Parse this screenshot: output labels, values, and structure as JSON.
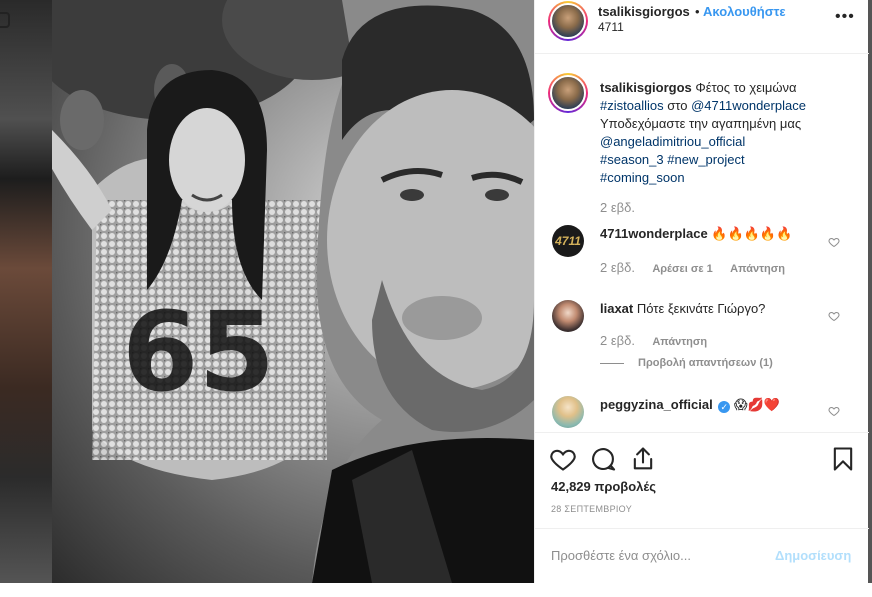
{
  "post": {
    "username": "tsalikisgiorgos",
    "separator": "•",
    "follow_label": "Ακολουθήστε",
    "location": "4711",
    "more_label": "•••",
    "caption": {
      "username": "tsalikisgiorgos",
      "text_1": "Φέτος το χειμώνα",
      "tag_zisto": "#zistoallios",
      "text_2": "στο",
      "mention_4711": "@4711wonderplace",
      "text_3": "Υποδεχόμαστε την αγαπημένη μας",
      "mention_angela": "@angeladimitriou_official",
      "tag_season": "#season_3",
      "tag_project": "#new_project",
      "tag_coming": "#coming_soon",
      "time": "2 εβδ."
    },
    "comments": [
      {
        "username": "4711wonderplace",
        "avatar_text": "4711",
        "text": "🔥🔥🔥🔥🔥",
        "time": "2 εβδ.",
        "likes": "Αρέσει σε 1",
        "reply_label": "Απάντηση"
      },
      {
        "username": "liaxat",
        "text": "Πότε ξεκινάτε Γιώργο?",
        "time": "2 εβδ.",
        "reply_label": "Απάντηση",
        "view_replies": "Προβολή απαντήσεων (1)"
      },
      {
        "username": "peggyzina_official",
        "verified": "✓",
        "text": "😱💋❤️"
      }
    ],
    "views": "42,829 προβολές",
    "date": "28 ΣΕΠΤΕΜΒΡΙΟΥ",
    "comment_placeholder": "Προσθέστε ένα σχόλιο...",
    "post_button": "Δημοσίευση"
  },
  "colors": {
    "accent": "#3897f0",
    "link": "#003569",
    "muted": "#8e8e8e",
    "disabled_post": "#b2dffc"
  },
  "icons": [
    "more-options-icon",
    "like-icon",
    "comment-icon",
    "share-icon",
    "save-icon",
    "comment-like-icon",
    "verified-badge-icon"
  ]
}
